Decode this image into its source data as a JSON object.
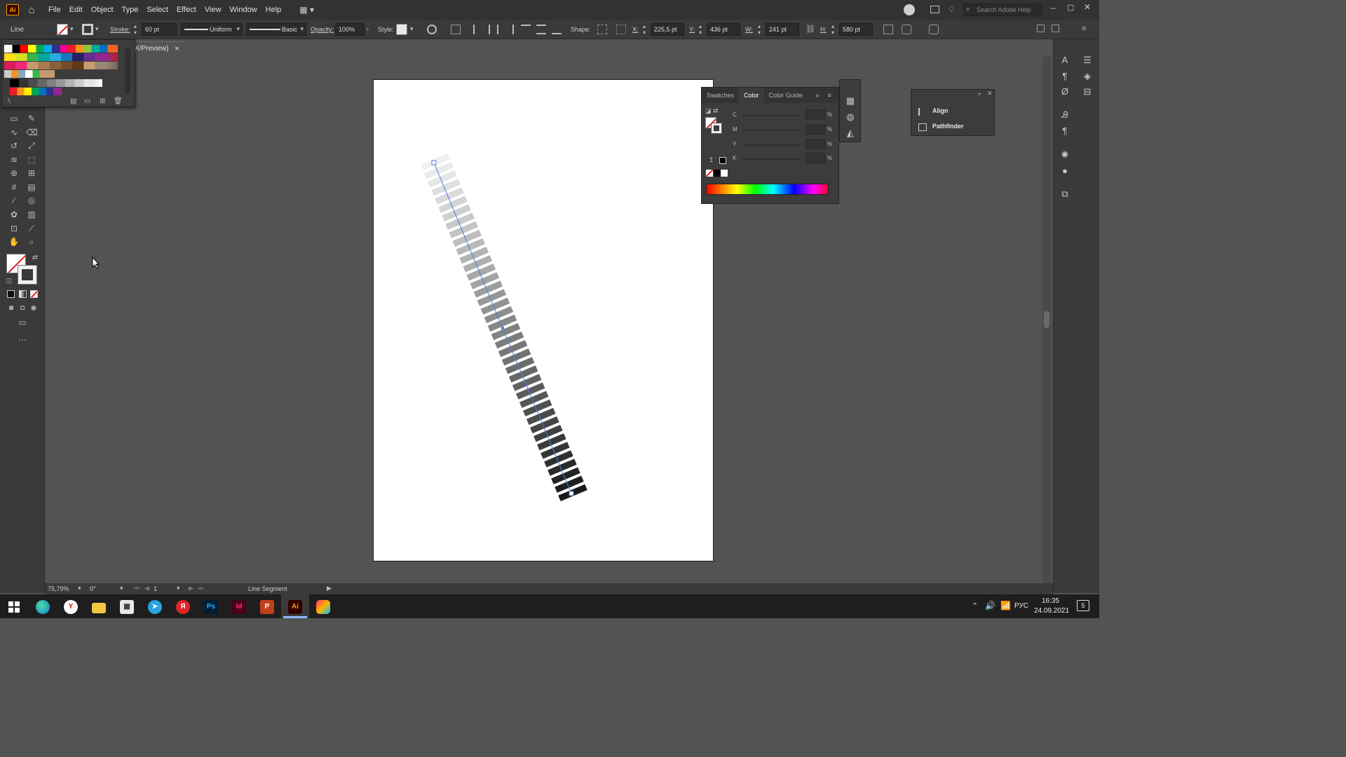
{
  "app": {
    "logo": "Ai"
  },
  "menu": [
    "File",
    "Edit",
    "Object",
    "Type",
    "Select",
    "Effect",
    "View",
    "Window",
    "Help"
  ],
  "search": {
    "placeholder": "Search Adobe Help"
  },
  "control_bar": {
    "selection_type": "Line",
    "stroke_label": "Stroke:",
    "stroke_value": "60 pt",
    "profile_value": "Uniform",
    "brush_value": "Basic",
    "opacity_label": "Opacity:",
    "opacity_value": "100%",
    "style_label": "Style:",
    "shape_label": "Shape:",
    "x_label": "X:",
    "x_value": "225,5 pt",
    "y_label": "Y:",
    "y_value": "436 pt",
    "w_label": "W:",
    "w_value": "241 pt",
    "h_label": "H:",
    "h_value": "580 pt"
  },
  "document_tab": {
    "title": "X/Preview)",
    "close": "×"
  },
  "color_panel": {
    "tabs": [
      "Swatches",
      "Color",
      "Color Guide"
    ],
    "active_tab": "Color",
    "channels": [
      {
        "label": "C",
        "unit": "%"
      },
      {
        "label": "M",
        "unit": "%"
      },
      {
        "label": "Y",
        "unit": "%"
      },
      {
        "label": "K",
        "unit": "%"
      }
    ]
  },
  "align_panel": {
    "items": [
      "Align",
      "Pathfinder"
    ]
  },
  "status_bar": {
    "zoom": "75,79%",
    "rotation": "0°",
    "artboard_number": "1",
    "tool_status": "Line Segment"
  },
  "taskbar": {
    "apps": [
      "Edge",
      "Yandex Browser",
      "File Explorer",
      "Microsoft Store",
      "Telegram",
      "Yandex",
      "Ps",
      "Id",
      "PowerPoint",
      "Ai",
      "Creative Cloud"
    ],
    "language": "РУС",
    "time": "16:35",
    "date": "24.09.2021",
    "notifications": "5"
  },
  "colors": {
    "ui_dark": "#323232",
    "panel": "#3c3c3c",
    "canvas": "#535353",
    "accent": "#ff9a00",
    "path_blue": "#4c7ee6"
  }
}
